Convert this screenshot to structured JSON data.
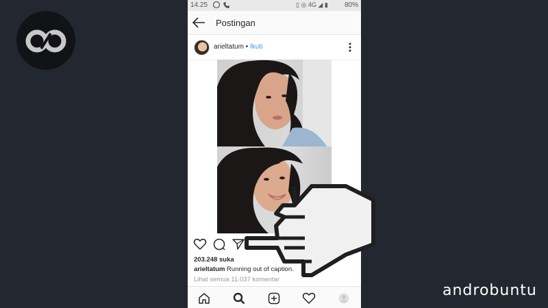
{
  "brand": {
    "name": "androbuntu"
  },
  "status_bar": {
    "time": "14.25",
    "network": "4G",
    "battery": "80%"
  },
  "app_bar": {
    "title": "Postingan"
  },
  "post": {
    "username": "arieltatum",
    "follow_label": "Ikuti",
    "separator": " • ",
    "likes": "203.248 suka",
    "caption_user": "arieltatum",
    "caption_text": "Running out of caption.",
    "comments_link": "Lihat semua 11.037 komentar"
  },
  "bottom_nav": [
    {
      "icon": "home-icon"
    },
    {
      "icon": "search-icon"
    },
    {
      "icon": "add-post-icon"
    },
    {
      "icon": "heart-icon"
    },
    {
      "icon": "profile-icon"
    }
  ],
  "colors": {
    "link": "#3897f0",
    "background": "#23272f",
    "text": "#262626"
  }
}
